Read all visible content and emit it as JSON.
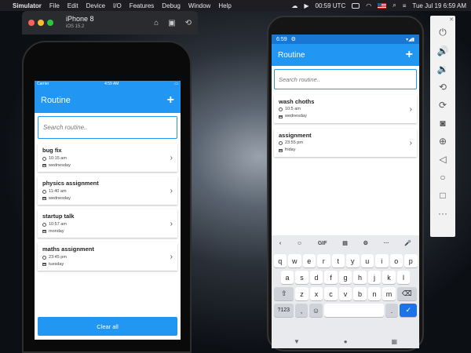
{
  "menubar": {
    "app": "Simulator",
    "menus": [
      "File",
      "Edit",
      "Device",
      "I/O",
      "Features",
      "Debug",
      "Window",
      "Help"
    ],
    "clock_left": "00:59 UTC",
    "date_time": "Tue Jul 19  6:59 AM"
  },
  "simulator": {
    "device": "iPhone 8",
    "os": "iOS 15.2"
  },
  "ios": {
    "status": {
      "carrier": "Carrier",
      "time": "4:59 AM"
    },
    "title": "Routine",
    "add": "+",
    "search_placeholder": "Search routine..",
    "items": [
      {
        "title": "bug fix",
        "time": "10:15 am",
        "day": "wednesday"
      },
      {
        "title": "physics assignment",
        "time": "11:40 am",
        "day": "wednesday"
      },
      {
        "title": "startup talk",
        "time": "10:57 am",
        "day": "monday"
      },
      {
        "title": "maths assignment",
        "time": "23:45 pm",
        "day": "tuesday"
      }
    ],
    "clear_all": "Clear all"
  },
  "android": {
    "status": {
      "time": "6:59"
    },
    "title": "Routine",
    "add": "+",
    "search_placeholder": "Search routine..",
    "items": [
      {
        "title": "wash choths",
        "time": "10:5 am",
        "day": "wednesday"
      },
      {
        "title": "assignment",
        "time": "23:55 pm",
        "day": "friday"
      }
    ],
    "keyboard": {
      "suggestions": [
        "‹",
        "☺",
        "GIF",
        "▤",
        "⚙",
        "···",
        "🎤"
      ],
      "row1": [
        "q",
        "w",
        "e",
        "r",
        "t",
        "y",
        "u",
        "i",
        "o",
        "p"
      ],
      "row2": [
        "a",
        "s",
        "d",
        "f",
        "g",
        "h",
        "j",
        "k",
        "l"
      ],
      "row3": [
        "z",
        "x",
        "c",
        "v",
        "b",
        "n",
        "m"
      ],
      "symbols": "?123",
      "comma": ",",
      "period": ".",
      "enter": "✓"
    }
  },
  "colors": {
    "primary": "#2196f3"
  }
}
